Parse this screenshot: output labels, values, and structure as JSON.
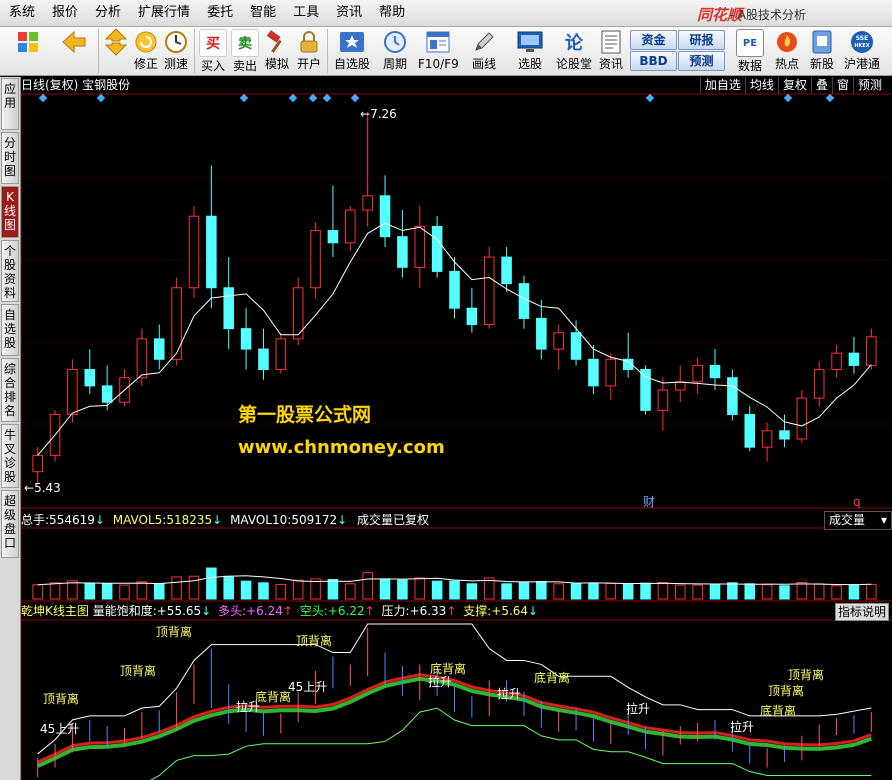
{
  "menubar": {
    "items": [
      "系统",
      "报价",
      "分析",
      "扩展行情",
      "委托",
      "智能",
      "工具",
      "资讯",
      "帮助"
    ],
    "brand": "同花顺",
    "brand_sub": "- A股技术分析"
  },
  "toolbar": {
    "buttons": [
      {
        "label": "",
        "icon": "windows-icon"
      },
      {
        "label": "",
        "icon": "back-arrow-icon"
      },
      {
        "label": "修正",
        "icon": "fix-icon"
      },
      {
        "label": "测速",
        "icon": "clock-icon"
      },
      {
        "label": "买入",
        "icon": "buy-icon",
        "glyph": "买"
      },
      {
        "label": "卖出",
        "icon": "sell-icon",
        "glyph": "卖"
      },
      {
        "label": "模拟",
        "icon": "hammer-icon"
      },
      {
        "label": "开户",
        "icon": "lock-icon"
      },
      {
        "label": "自选股",
        "icon": "star-icon"
      },
      {
        "label": "周期",
        "icon": "cycle-icon"
      },
      {
        "label": "F10/F9",
        "icon": "f10-icon"
      },
      {
        "label": "画线",
        "icon": "pen-icon"
      },
      {
        "label": "选股",
        "icon": "screen-icon"
      },
      {
        "label": "论股堂",
        "icon": "discuss-icon",
        "glyph": "论"
      },
      {
        "label": "资讯",
        "icon": "news-icon"
      },
      {
        "label": "数据",
        "icon": "pe-icon",
        "glyph": "PE"
      },
      {
        "label": "热点",
        "icon": "hot-icon"
      },
      {
        "label": "新股",
        "icon": "ipo-icon"
      },
      {
        "label": "沪港通",
        "icon": "sse-hkex-icon"
      }
    ],
    "blue_buttons": [
      "资金",
      "研报",
      "BBD",
      "预测"
    ]
  },
  "sidebar": {
    "tabs": [
      "应用",
      "分时图",
      "K线图",
      "个股资料",
      "自选股",
      "综合排名",
      "牛叉诊股",
      "超级盘口"
    ],
    "active": "K线图"
  },
  "chart": {
    "header": "日线(复权)  宝钢股份",
    "toplinks": [
      "加自选",
      "均线",
      "复权",
      "叠",
      "窗",
      "预测"
    ],
    "high_label": "7.26",
    "low_label": "5.43",
    "marker_cai": "财",
    "marker_q": "q",
    "colors": {
      "up": "#ff3030",
      "down": "#54ffff",
      "ma": "#ffffff",
      "grid": "#7a0000"
    }
  },
  "chart_data": {
    "type": "candlestick",
    "title": "宝钢股份",
    "high": 7.26,
    "low": 5.43,
    "ohlc": [
      [
        5.5,
        5.62,
        5.43,
        5.58
      ],
      [
        5.58,
        5.8,
        5.55,
        5.78
      ],
      [
        5.78,
        6.05,
        5.74,
        6.0
      ],
      [
        6.0,
        6.1,
        5.88,
        5.92
      ],
      [
        5.92,
        6.02,
        5.8,
        5.84
      ],
      [
        5.84,
        6.0,
        5.82,
        5.96
      ],
      [
        5.96,
        6.2,
        5.92,
        6.15
      ],
      [
        6.15,
        6.22,
        6.0,
        6.05
      ],
      [
        6.05,
        6.45,
        6.02,
        6.4
      ],
      [
        6.4,
        6.8,
        6.35,
        6.75
      ],
      [
        6.75,
        7.0,
        6.3,
        6.4
      ],
      [
        6.4,
        6.55,
        6.1,
        6.2
      ],
      [
        6.2,
        6.3,
        6.0,
        6.1
      ],
      [
        6.1,
        6.2,
        5.95,
        6.0
      ],
      [
        6.0,
        6.18,
        5.98,
        6.15
      ],
      [
        6.15,
        6.45,
        6.12,
        6.4
      ],
      [
        6.4,
        6.72,
        6.35,
        6.68
      ],
      [
        6.68,
        6.9,
        6.55,
        6.62
      ],
      [
        6.62,
        6.8,
        6.58,
        6.78
      ],
      [
        6.78,
        7.26,
        6.7,
        6.85
      ],
      [
        6.85,
        6.95,
        6.6,
        6.65
      ],
      [
        6.65,
        6.78,
        6.45,
        6.5
      ],
      [
        6.5,
        6.8,
        6.4,
        6.7
      ],
      [
        6.7,
        6.75,
        6.45,
        6.48
      ],
      [
        6.48,
        6.55,
        6.25,
        6.3
      ],
      [
        6.3,
        6.4,
        6.18,
        6.22
      ],
      [
        6.22,
        6.6,
        6.2,
        6.55
      ],
      [
        6.55,
        6.6,
        6.38,
        6.42
      ],
      [
        6.42,
        6.46,
        6.2,
        6.25
      ],
      [
        6.25,
        6.34,
        6.05,
        6.1
      ],
      [
        6.1,
        6.22,
        6.0,
        6.18
      ],
      [
        6.18,
        6.24,
        6.02,
        6.05
      ],
      [
        6.05,
        6.12,
        5.88,
        5.92
      ],
      [
        5.92,
        6.08,
        5.85,
        6.05
      ],
      [
        6.05,
        6.18,
        5.96,
        6.0
      ],
      [
        6.0,
        6.02,
        5.78,
        5.8
      ],
      [
        5.8,
        5.96,
        5.7,
        5.9
      ],
      [
        5.9,
        6.02,
        5.84,
        5.94
      ],
      [
        5.94,
        6.06,
        5.88,
        6.02
      ],
      [
        6.02,
        6.1,
        5.9,
        5.96
      ],
      [
        5.96,
        6.0,
        5.75,
        5.78
      ],
      [
        5.78,
        5.82,
        5.6,
        5.62
      ],
      [
        5.62,
        5.74,
        5.55,
        5.7
      ],
      [
        5.7,
        5.78,
        5.62,
        5.66
      ],
      [
        5.66,
        5.9,
        5.64,
        5.86
      ],
      [
        5.86,
        6.04,
        5.82,
        6.0
      ],
      [
        6.0,
        6.12,
        5.96,
        6.08
      ],
      [
        6.08,
        6.16,
        5.98,
        6.02
      ],
      [
        6.02,
        6.2,
        6.0,
        6.16
      ]
    ]
  },
  "volume": {
    "label_total": "总手:",
    "total": "554619",
    "label_mavol5": "MAVOL5:",
    "mavol5": "518235",
    "label_mavol10": "MAVOL10:",
    "mavol10": "509172",
    "note": "成交量已复权",
    "select_value": "成交量",
    "arrow_down": "↓"
  },
  "indicator": {
    "name": "乾坤K线主图",
    "items": [
      {
        "label": "量能饱和度:",
        "value": "+55.65",
        "arrow": "↓",
        "color": "#ffffff"
      },
      {
        "label": "多头:",
        "value": "+6.24",
        "arrow": "↑",
        "color": "#ff66ff"
      },
      {
        "label": "空头:",
        "value": "+6.22",
        "arrow": "↑",
        "color": "#33ff33"
      },
      {
        "label": "压力:",
        "value": "+6.33",
        "arrow": "↑",
        "color": "#ffffff"
      },
      {
        "label": "支撑:",
        "value": "+5.64",
        "arrow": "↓",
        "color": "#ffff66"
      }
    ],
    "explain_button": "指标说明",
    "annotations": [
      "顶背离",
      "顶背离",
      "顶背离",
      "底背离",
      "底背离",
      "底背离",
      "底背离",
      "拉升",
      "拉升",
      "拉升",
      "拉升",
      "拉升",
      "45上升",
      "45上升",
      "顶背离"
    ]
  },
  "watermark": {
    "line1": "第一股票公式网",
    "line2": "www.chnmoney.com"
  }
}
